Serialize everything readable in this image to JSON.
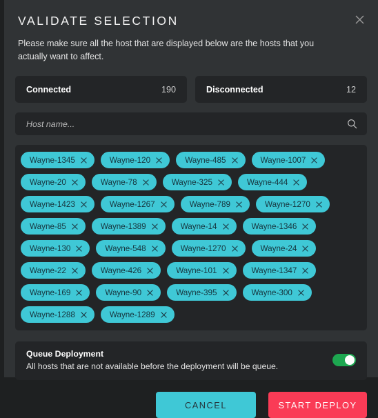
{
  "dialog": {
    "title": "VALIDATE SELECTION",
    "subtitle": "Please make sure all the host that are displayed below are the hosts that you actually want to affect.",
    "close_icon": "close-icon"
  },
  "tabs": [
    {
      "label": "Connected",
      "count": "190"
    },
    {
      "label": "Disconnected",
      "count": "12"
    }
  ],
  "search": {
    "placeholder": "Host name...",
    "value": "",
    "icon": "search-icon"
  },
  "hosts": [
    "Wayne-1345",
    "Wayne-120",
    "Wayne-485",
    "Wayne-1007",
    "Wayne-20",
    "Wayne-78",
    "Wayne-325",
    "Wayne-444",
    "Wayne-1423",
    "Wayne-1267",
    "Wayne-789",
    "Wayne-1270",
    "Wayne-85",
    "Wayne-1389",
    "Wayne-14",
    "Wayne-1346",
    "Wayne-130",
    "Wayne-548",
    "Wayne-1270",
    "Wayne-24",
    "Wayne-22",
    "Wayne-426",
    "Wayne-101",
    "Wayne-1347",
    "Wayne-169",
    "Wayne-90",
    "Wayne-395",
    "Wayne-300",
    "Wayne-1288",
    "Wayne-1289"
  ],
  "queue": {
    "title": "Queue Deployment",
    "description": "All hosts that are not available before the deployment will be queue.",
    "toggle_on": true
  },
  "footer": {
    "cancel_label": "CANCEL",
    "deploy_label": "START DEPLOY"
  },
  "colors": {
    "accent_cyan": "#3FC8D6",
    "danger_red": "#FA3B56",
    "toggle_green": "#1DA750",
    "panel_bg": "#232527",
    "modal_bg": "#303335"
  }
}
